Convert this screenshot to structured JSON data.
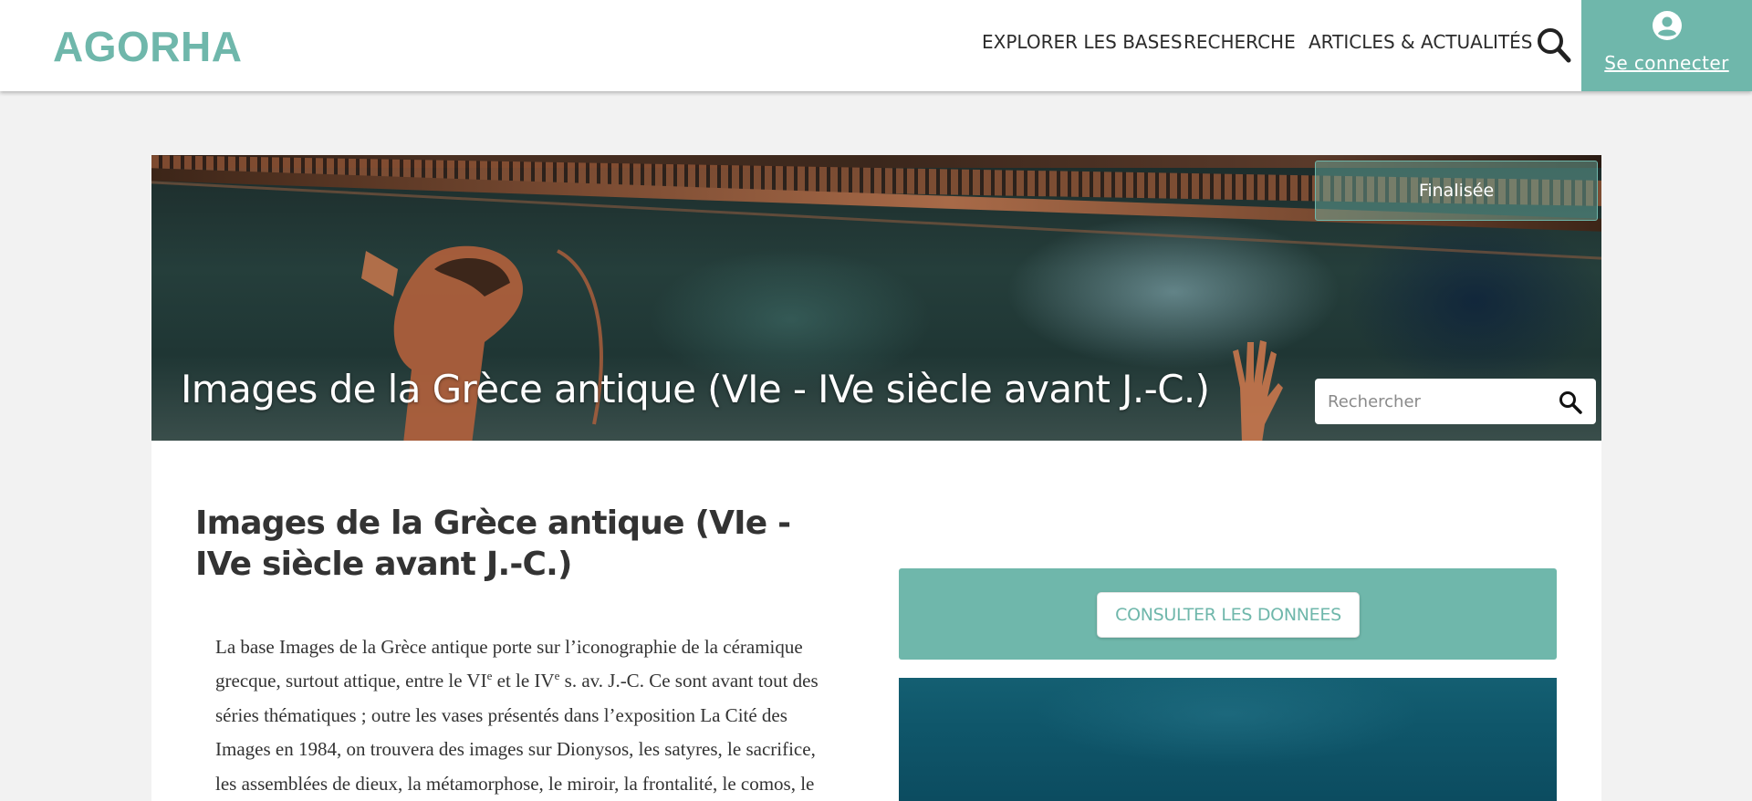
{
  "header": {
    "logo": "AGORHA",
    "nav": [
      {
        "label": "EXPLORER LES BASES"
      },
      {
        "label": "RECHERCHE"
      },
      {
        "label": "ARTICLES & ACTUALITÉS"
      }
    ],
    "search_icon": "search-icon",
    "login": {
      "icon": "account-circle-icon",
      "label": "Se connecter"
    }
  },
  "banner": {
    "title": "Images de la Grèce antique (VIe - IVe siècle avant J.-C.)",
    "status": "Finalisée",
    "search": {
      "placeholder": "Rechercher",
      "icon": "search-icon"
    }
  },
  "content": {
    "title": "Images de la Grèce antique (VIe - IVe siècle avant J.-C.)",
    "description": {
      "line1": "La base Images de la Grèce antique porte sur l’iconographie de la céramique",
      "seg_a": "grecque, surtout attique, entre le VI",
      "sup1": "e",
      "seg_b": " et le IV",
      "sup2": "e",
      "seg_c": " s. av. J.-C. Ce sont avant tout des",
      "line3": "séries thématiques ; outre les vases présentés dans l’exposition La Cité des",
      "line4": "Images en 1984, on trouvera des images sur Dionysos, les satyres, le sacrifice,",
      "line5": "les assemblées de dieux, la métamorphose, le miroir, la frontalité, le comos, le"
    },
    "consult_button": "CONSULTER LES DONNEES"
  },
  "colors": {
    "accent": "#6fb7ab",
    "text": "#333333",
    "page_bg": "#f2f2f2"
  }
}
